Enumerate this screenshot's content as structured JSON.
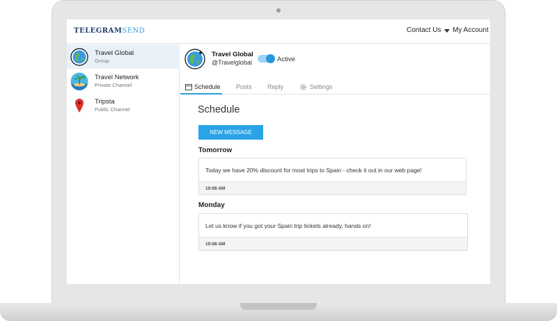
{
  "brand": {
    "part1": "TELEGRAM",
    "part2": "SEND"
  },
  "topbar": {
    "contact": "Contact Us",
    "account": "My Account"
  },
  "sidebar": {
    "items": [
      {
        "name": "Travel Global",
        "type": "Group",
        "icon": "globe-icon"
      },
      {
        "name": "Travel Network",
        "type": "Private Channel",
        "icon": "island-icon"
      },
      {
        "name": "Tripsta",
        "type": "Public Channel",
        "icon": "map-pin-icon"
      }
    ]
  },
  "group": {
    "name": "Travel Global",
    "handle": "@Travelglobal",
    "status": "Active",
    "active": true
  },
  "tabs": [
    "Schedule",
    "Posts",
    "Reply",
    "Settings"
  ],
  "main": {
    "title": "Schedule",
    "new_message": "NEW MESSAGE",
    "days": [
      {
        "label": "Tomorrow",
        "message": "Today we have 20% discount for most trips to Spain - check it out in our web page!",
        "time": "10:08 AM"
      },
      {
        "label": "Monday",
        "message": "Let us know if you got your Spain trip tickets already, hands on!",
        "time": "10:08 AM"
      }
    ]
  },
  "colors": {
    "accent": "#2aa4e6",
    "brand_dark": "#1c3d6a",
    "selected_row": "#e8f1f8"
  }
}
